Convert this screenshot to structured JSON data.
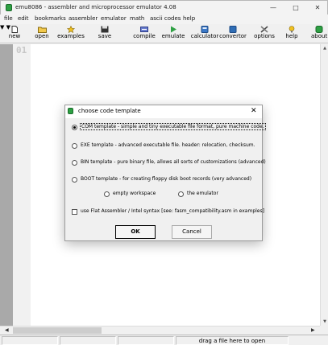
{
  "window": {
    "title": "emu8086 - assembler and microprocessor emulator 4.08"
  },
  "menu": [
    "file",
    "edit",
    "bookmarks",
    "assembler",
    "emulator",
    "math",
    "ascii codes",
    "help"
  ],
  "toolbar": {
    "new": "new",
    "open": "open",
    "examples": "examples",
    "save": "save",
    "compile": "compile",
    "emulate": "emulate",
    "calculator": "calculator",
    "convertor": "convertor",
    "options": "options",
    "help": "help",
    "about": "about"
  },
  "editor": {
    "line_number": "01"
  },
  "status": {
    "message": "drag a file here to open"
  },
  "dialog": {
    "title": "choose code template",
    "options": {
      "com": "COM template - simple and tiny executable file format, pure machine code.",
      "exe": "EXE template - advanced executable file. header: relocation, checksum.",
      "bin": "BIN template - pure binary file, allows all sorts of customizations (advanced)",
      "boot": "BOOT template - for creating floppy disk boot records (very advanced)",
      "empty": "empty workspace",
      "emulator": "the emulator"
    },
    "selected": "com",
    "checkbox": "use Flat Assembler / Intel syntax   [see: fasm_compatibility.asm in examples]",
    "ok": "OK",
    "cancel": "Cancel"
  },
  "colors": {
    "accent_green": "#2ea043",
    "gutter_gray": "#a9a9a9"
  }
}
